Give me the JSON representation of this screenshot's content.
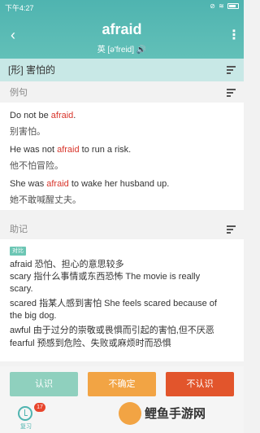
{
  "status": {
    "time": "下午4:27"
  },
  "header": {
    "word": "afraid",
    "phonetic": "英 [ə'freid] 🔊"
  },
  "pos_bar": {
    "label": "[形] 害怕的"
  },
  "examples_section": {
    "title": "例句"
  },
  "examples": [
    {
      "pre": "Do not be ",
      "hl": "afraid",
      "post": ".",
      "cn": "别害怕。"
    },
    {
      "pre": "He was not ",
      "hl": "afraid",
      "post": " to run a risk.",
      "cn": "他不怕冒险。"
    },
    {
      "pre": "She was ",
      "hl": "afraid",
      "post": " to wake her husband up.",
      "cn": "她不敢喊醒丈夫。"
    }
  ],
  "memo_section": {
    "title": "助记",
    "tag": "对比"
  },
  "memo_lines": [
    "afraid   恐怕、担心的意思较多",
    "scary   指什么事情或东西恐怖   The movie is really",
    "scary.",
    "scared 指某人感到害怕   She feels scared  because of",
    "the big dog.",
    "awful   由于过分的崇敬或畏惧而引起的害怕,但不厌恶",
    "fearful  预感到危险、失败或麻烦时而恐惧"
  ],
  "buttons": {
    "know": "认识",
    "unsure": "不确定",
    "unknown": "不认识"
  },
  "review": {
    "label": "复习",
    "count": "17"
  },
  "watermark": {
    "text": "鲤鱼手游网"
  }
}
